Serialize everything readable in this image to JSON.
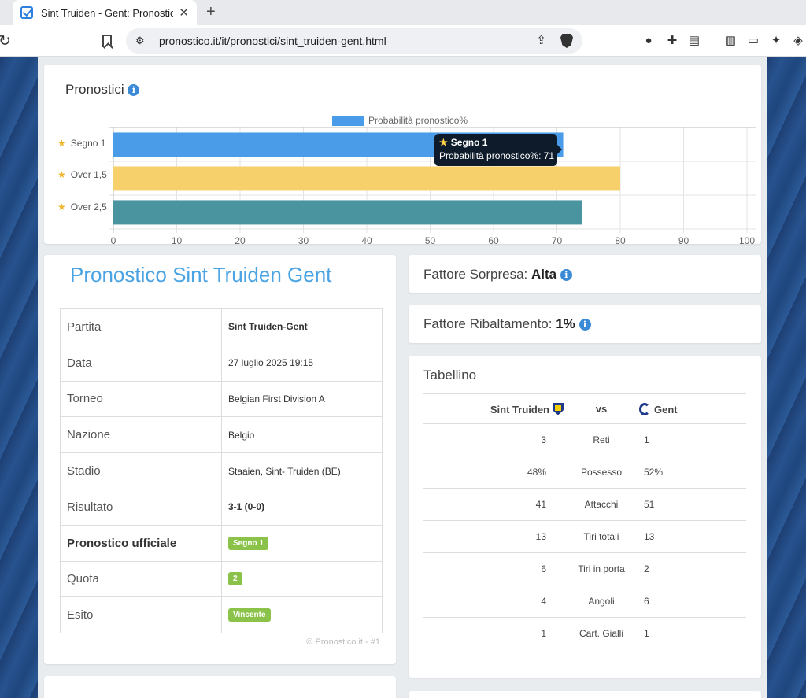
{
  "browser": {
    "tab_title": "Sint Truiden - Gent: Pronostico",
    "url": "pronostico.it/it/pronostici/sint_truiden-gent.html"
  },
  "pronostici_card": {
    "title": "Pronostici",
    "tooltip": {
      "title": "Segno 1",
      "body": "Probabilità pronostico%: 71"
    }
  },
  "chart_data": {
    "type": "bar",
    "orientation": "horizontal",
    "categories": [
      "Segno 1",
      "Over 1,5",
      "Over 2,5"
    ],
    "series": [
      {
        "name": "Probabilità pronostico%",
        "values": [
          71,
          80,
          74
        ]
      }
    ],
    "bar_colors": [
      "#4a9be8",
      "#f6d06b",
      "#4a949f"
    ],
    "xlim": [
      0,
      100
    ],
    "ticks": [
      "0",
      "10",
      "20",
      "30",
      "40",
      "50",
      "60",
      "70",
      "80",
      "90",
      "100"
    ],
    "grid": true,
    "legend": "top"
  },
  "pronostico": {
    "title": "Pronostico Sint Truiden Gent",
    "rows": [
      {
        "label": "Partita",
        "value": "Sint Truiden-Gent"
      },
      {
        "label": "Data",
        "value": "27 luglio 2025 19:15"
      },
      {
        "label": "Torneo",
        "value": "Belgian First Division A"
      },
      {
        "label": "Nazione",
        "value": "Belgio"
      },
      {
        "label": "Stadio",
        "value": "Staaien, Sint- Truiden (BE)"
      },
      {
        "label": "Risultato",
        "value": "3-1 (0-0)"
      },
      {
        "label": "Pronostico ufficiale",
        "value": "Segno 1"
      },
      {
        "label": "Quota",
        "value": "2"
      },
      {
        "label": "Esito",
        "value": "Vincente"
      }
    ],
    "copyright": "© Pronostico.it - #1"
  },
  "fattore_sorpresa": {
    "label": "Fattore Sorpresa:",
    "value": "Alta"
  },
  "fattore_ribaltamento": {
    "label": "Fattore Ribaltamento:",
    "value": "1%"
  },
  "tabellino": {
    "title": "Tabellino",
    "home": "Sint Truiden",
    "vs": "vs",
    "away": "Gent",
    "stats": [
      {
        "home": "3",
        "label": "Reti",
        "away": "1"
      },
      {
        "home": "48%",
        "label": "Possesso",
        "away": "52%"
      },
      {
        "home": "41",
        "label": "Attacchi",
        "away": "51"
      },
      {
        "home": "13",
        "label": "Tiri totali",
        "away": "13"
      },
      {
        "home": "6",
        "label": "Tiri in porta",
        "away": "2"
      },
      {
        "home": "4",
        "label": "Angoli",
        "away": "6"
      },
      {
        "home": "1",
        "label": "Cart. Gialli",
        "away": "1"
      }
    ]
  }
}
